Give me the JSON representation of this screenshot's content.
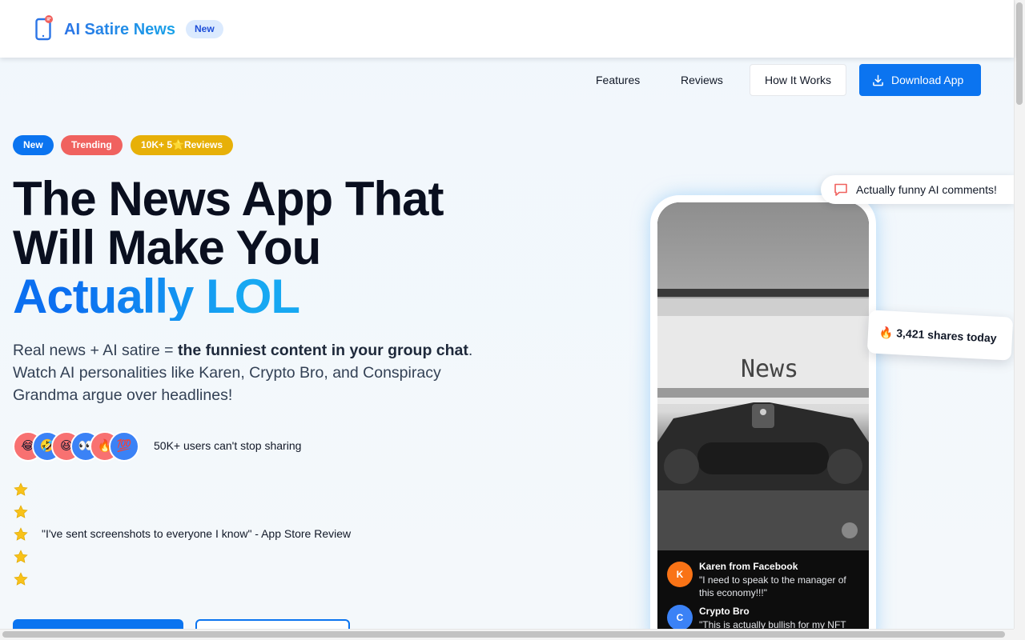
{
  "header": {
    "brand_name": "AI Satire News",
    "brand_badge": "New"
  },
  "nav": {
    "features": "Features",
    "reviews": "Reviews",
    "how_it_works": "How It Works",
    "download": "Download App"
  },
  "hero": {
    "badges": [
      {
        "label": "New",
        "color": "#0b74f0"
      },
      {
        "label": "Trending",
        "color": "#f0625f"
      },
      {
        "label": "10K+ 5⭐Reviews",
        "color": "#e7b008"
      }
    ],
    "headline_line1": "The News App That",
    "headline_line2": "Will Make You",
    "headline_accent": "Actually LOL",
    "subcopy_start": "Real news + AI satire = ",
    "subcopy_bold": "the funniest content in your group chat",
    "subcopy_end": ". Watch AI personalities like Karen, Crypto Bro, and Conspiracy Grandma argue over headlines!",
    "avatars": [
      {
        "emoji": "😂",
        "color": "#f87171"
      },
      {
        "emoji": "🤣",
        "color": "#3b82f6"
      },
      {
        "emoji": "😆",
        "color": "#f87171"
      },
      {
        "emoji": "👀",
        "color": "#3b82f6"
      },
      {
        "emoji": "🔥",
        "color": "#f87171"
      },
      {
        "emoji": "💯",
        "color": "#3b82f6"
      }
    ],
    "users_text": "50K+ users can't stop sharing",
    "stars": [
      "⭐",
      "⭐",
      "⭐",
      "⭐",
      "⭐"
    ],
    "review_quote": "\"I've sent screenshots to everyone I know\" - App Store Review"
  },
  "phone": {
    "comments": [
      {
        "initial": "K",
        "name": "Karen from Facebook",
        "text": "\"I need to speak to the manager of this economy!!!\"",
        "color": "#f97316"
      },
      {
        "initial": "C",
        "name": "Crypto Bro",
        "text": "\"This is actually bullish for my NFT",
        "color": "#3b82f6"
      }
    ],
    "photo_text": "News",
    "floating_comments": "Actually funny AI comments!",
    "floating_shares": "🔥 3,421 shares today"
  },
  "colors": {
    "primary": "#0b74f0",
    "accent_gradient_end": "#17a8f2"
  }
}
